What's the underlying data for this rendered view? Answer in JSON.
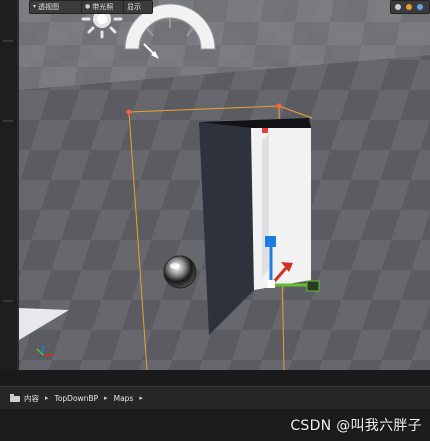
{
  "toolbar": {
    "perspective_label": "透视图",
    "lit_label": "带光照",
    "show_label": "显示"
  },
  "breadcrumb": {
    "root_label": "内容",
    "items": [
      "TopDownBP",
      "Maps"
    ]
  },
  "watermark": "CSDN @叫我六胖子",
  "colors": {
    "editor_bg": "#151515",
    "viewport_floor": "#5b5d62",
    "selection_outline": "#f0a030",
    "wall_dark": "#2e323d",
    "wall_light": "#f2f2f2",
    "gizmo_z": "#1e7de0",
    "gizmo_x": "#d03020",
    "gizmo_y": "#60c030"
  },
  "icons": {
    "perspective_toggle": "chevron-down-icon",
    "lit_toggle": "lightbulb-icon",
    "sun_gizmo": "sun-icon",
    "rotation_arc": "rotation-arc-icon",
    "content_root": "folder-icon",
    "axis_indicator": "axis-icon"
  }
}
